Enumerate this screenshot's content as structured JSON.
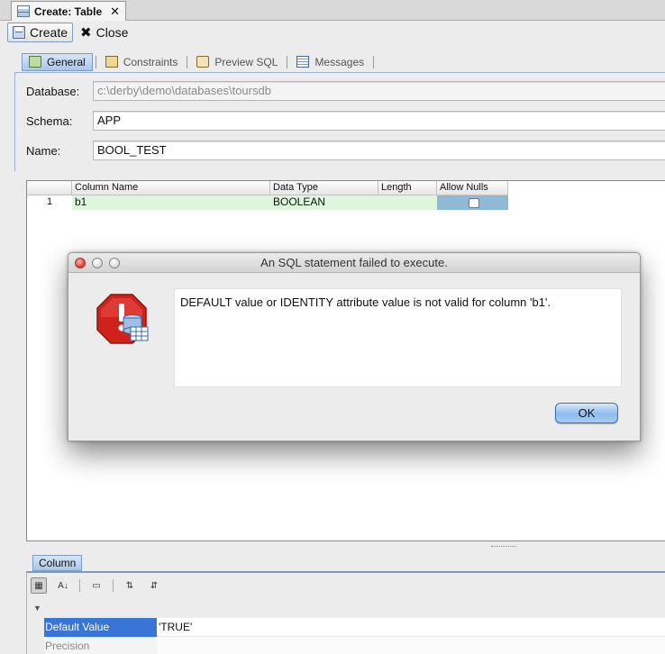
{
  "document_tab": {
    "title": "Create: Table",
    "close_glyph": "✕"
  },
  "toolbar": {
    "create_label": "Create",
    "close_label": "Close"
  },
  "subtabs": [
    {
      "label": "General",
      "icon": "general-icon",
      "active": true
    },
    {
      "label": "Constraints",
      "icon": "constraints-icon",
      "active": false
    },
    {
      "label": "Preview SQL",
      "icon": "preview-sql-icon",
      "active": false
    },
    {
      "label": "Messages",
      "icon": "messages-icon",
      "active": false
    }
  ],
  "general": {
    "database_label": "Database:",
    "database_value": "c:\\derby\\demo\\databases\\toursdb",
    "schema_label": "Schema:",
    "schema_value": "APP",
    "name_label": "Name:",
    "name_value": "BOOL_TEST"
  },
  "grid": {
    "headers": [
      "Column Name",
      "Data Type",
      "Length",
      "Allow Nulls"
    ],
    "rows": [
      {
        "row_number": "1",
        "column_name": "b1",
        "data_type": "BOOLEAN",
        "length": "",
        "allow_nulls": false
      }
    ]
  },
  "dialog": {
    "title": "An SQL statement failed to execute.",
    "message": "DEFAULT value or IDENTITY attribute value is not valid for column 'b1'.",
    "ok_label": "OK",
    "icon": "error-stop-database-icon"
  },
  "column_panel": {
    "tab_label": "Column",
    "properties": [
      {
        "name": "Default Value",
        "value": "'TRUE'"
      },
      {
        "name": "Precision",
        "value": ""
      }
    ]
  },
  "colors": {
    "selection_blue": "#3875d7",
    "row_highlight": "#dcf7dc",
    "dialog_error_red": "#d0211b"
  }
}
